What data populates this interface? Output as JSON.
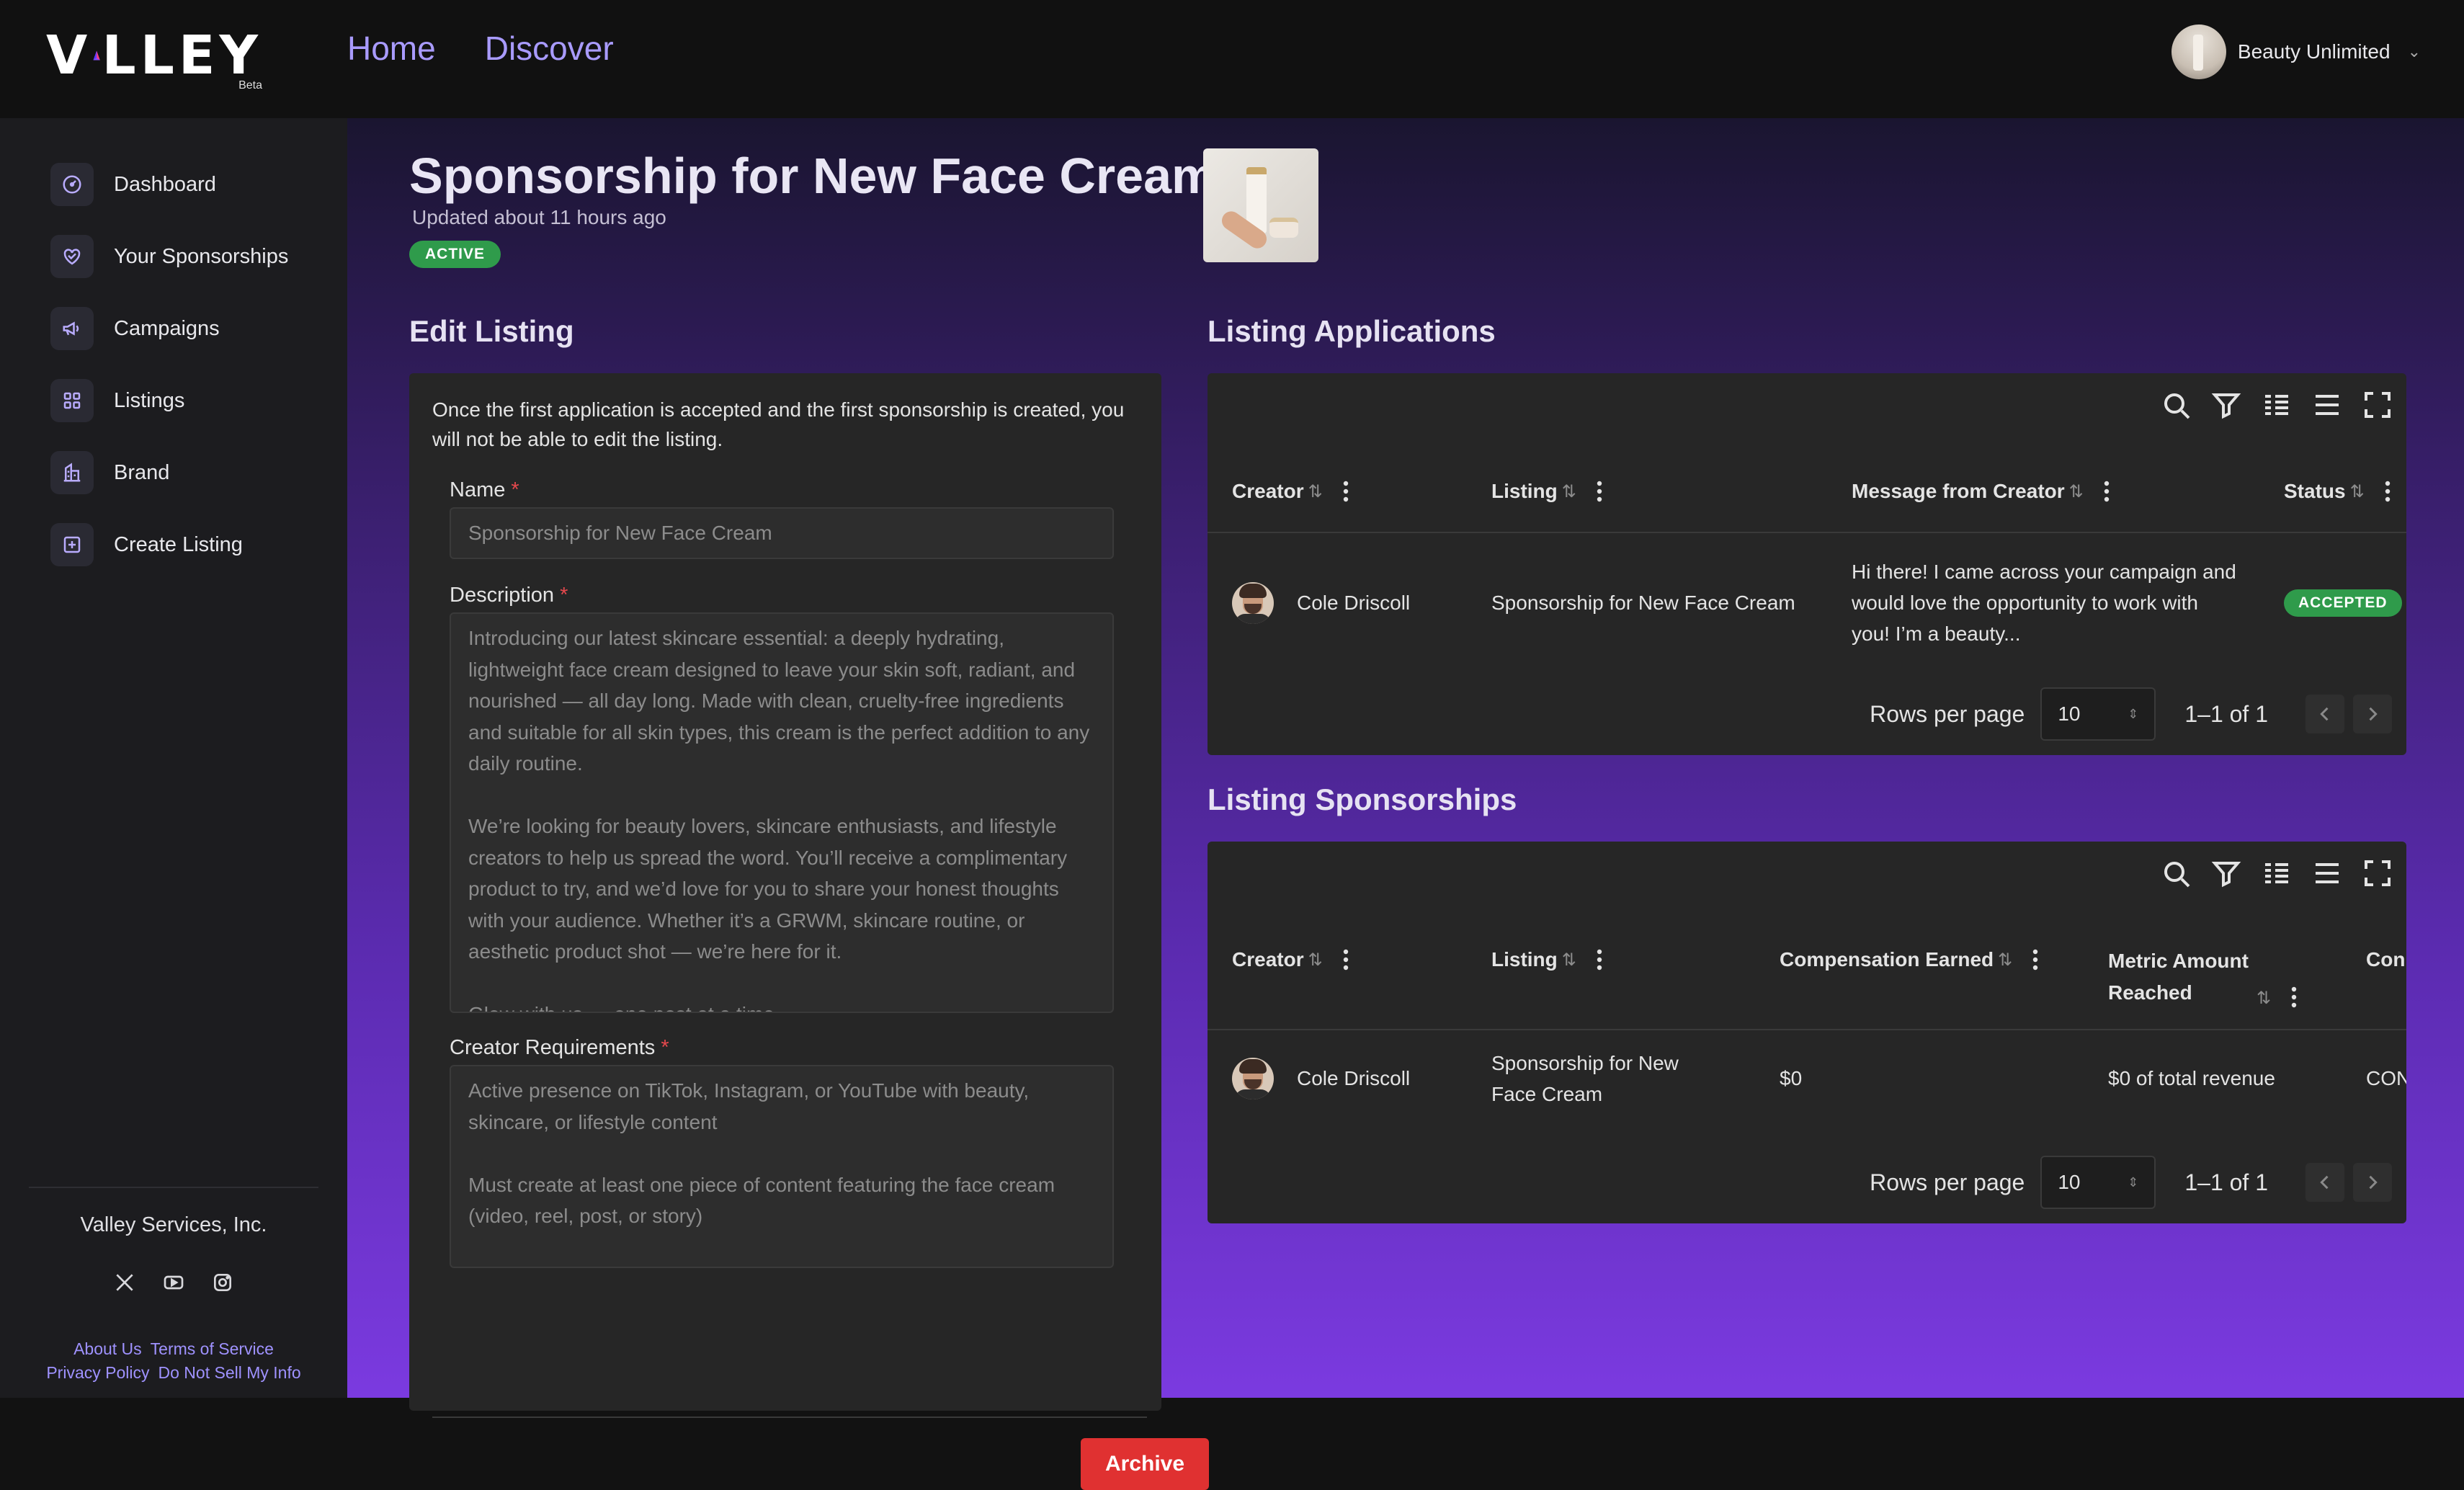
{
  "brand": {
    "logo": "VALLEY",
    "beta": "Beta"
  },
  "topnav": [
    {
      "label": "Home"
    },
    {
      "label": "Discover"
    }
  ],
  "account": {
    "name": "Beauty Unlimited"
  },
  "sidebar": {
    "items": [
      {
        "label": "Dashboard",
        "icon": "gauge-icon"
      },
      {
        "label": "Your Sponsorships",
        "icon": "heart-handshake-icon"
      },
      {
        "label": "Campaigns",
        "icon": "megaphone-icon"
      },
      {
        "label": "Listings",
        "icon": "grid-icon"
      },
      {
        "label": "Brand",
        "icon": "building-icon"
      },
      {
        "label": "Create Listing",
        "icon": "plus-square-icon"
      }
    ],
    "company": "Valley Services, Inc.",
    "links": {
      "about": "About Us",
      "terms": "Terms of Service",
      "privacy": "Privacy Policy",
      "dnsmi": "Do Not Sell My Info"
    }
  },
  "page": {
    "title": "Sponsorship for New Face Cream",
    "updated": "Updated about 11 hours ago",
    "status": "ACTIVE"
  },
  "edit": {
    "heading": "Edit Listing",
    "note": "Once the first application is accepted and the first sponsorship is created, you will not be able to edit the listing.",
    "name_label": "Name",
    "name_value": "Sponsorship for New Face Cream",
    "desc_label": "Description",
    "desc_p1": "Introducing our latest skincare essential: a deeply hydrating, lightweight face cream designed to leave your skin soft, radiant, and nourished — all day long. Made with clean, cruelty-free ingredients and suitable for all skin types, this cream is the perfect addition to any daily routine.",
    "desc_p2": "We’re looking for beauty lovers, skincare enthusiasts, and lifestyle creators to help us spread the word. You’ll receive a complimentary product to try, and we’d love for you to share your honest thoughts with your audience. Whether it’s a GRWM, skincare routine, or aesthetic product shot — we’re here for it.",
    "desc_p3": "Glow with us — one post at a time.",
    "req_label": "Creator Requirements",
    "req_p1": "Active presence on TikTok, Instagram, or YouTube with beauty, skincare, or lifestyle content",
    "req_p2": "Must create at least one piece of content featuring the face cream (video, reel, post, or story)",
    "archive": "Archive"
  },
  "applications": {
    "heading": "Listing Applications",
    "columns": {
      "creator": "Creator",
      "listing": "Listing",
      "message": "Message from Creator",
      "status": "Status"
    },
    "rows": [
      {
        "creator": "Cole Driscoll",
        "listing": "Sponsorship for New Face Cream",
        "message": "Hi there! I came across your campaign and would love the opportunity to work with you! I’m a beauty...",
        "status": "ACCEPTED"
      }
    ],
    "rows_per_page_label": "Rows per page",
    "rows_per_page": "10",
    "range": "1–1 of 1"
  },
  "sponsorships": {
    "heading": "Listing Sponsorships",
    "columns": {
      "creator": "Creator",
      "listing": "Listing",
      "compensation": "Compensation Earned",
      "metric": "Metric Amount Reached",
      "next": "Con"
    },
    "rows": [
      {
        "creator": "Cole Driscoll",
        "listing": "Sponsorship for New Face Cream",
        "compensation": "$0",
        "metric": "$0 of total revenue",
        "next": "CON"
      }
    ],
    "rows_per_page_label": "Rows per page",
    "rows_per_page": "10",
    "range": "1–1 of 1"
  },
  "colors": {
    "accent": "#a99bff",
    "active": "#2f9b4b",
    "danger": "#e03131"
  }
}
